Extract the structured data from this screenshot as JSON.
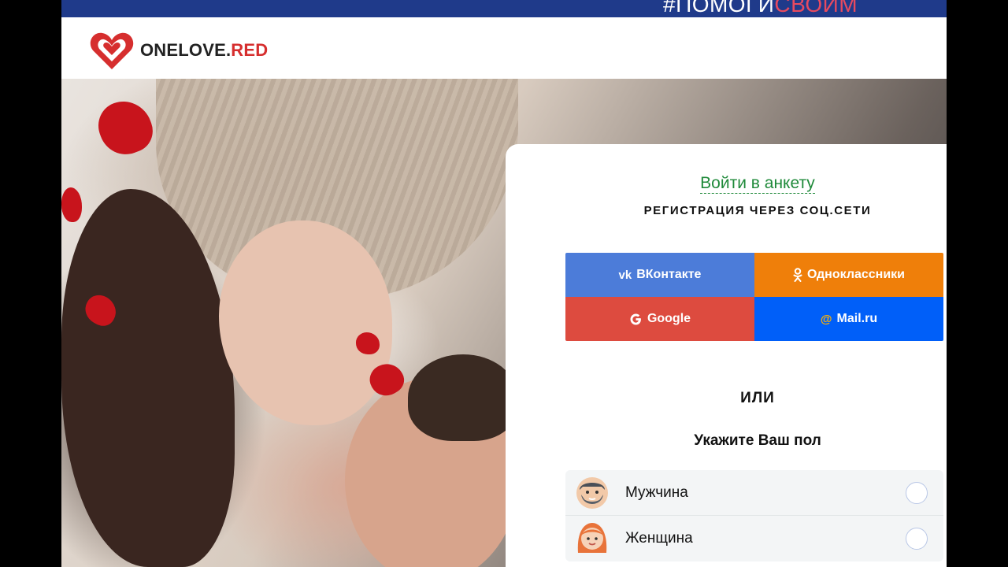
{
  "topbar": {
    "tag_part1": "#ПОМОГИ",
    "tag_part2": "СВОИМ"
  },
  "brand": {
    "name_prefix": "ONELOVE.",
    "name_suffix": "RED",
    "color": "#d62e2e"
  },
  "panel": {
    "login_link": "Войти в анкету",
    "social_title": "РЕГИСТРАЦИЯ ЧЕРЕЗ СОЦ.СЕТИ",
    "social_buttons": [
      {
        "label": "ВКонтакте",
        "icon": "vk-icon",
        "color": "#4c7cd9"
      },
      {
        "label": "Одноклассники",
        "icon": "odnoklassniki-icon",
        "color": "#ef7f0a"
      },
      {
        "label": "Google",
        "icon": "google-icon",
        "color": "#dd4b3f"
      },
      {
        "label": "Mail.ru",
        "icon": "at-icon",
        "color": "#005ff9"
      }
    ],
    "or_label": "ИЛИ",
    "gender_title": "Укажите Ваш пол",
    "gender_options": [
      {
        "label": "Мужчина",
        "icon": "man-avatar-icon",
        "selected": false
      },
      {
        "label": "Женщина",
        "icon": "woman-avatar-icon",
        "selected": false
      }
    ]
  },
  "colors": {
    "accent_green": "#1f8a3a",
    "topbar": "#1f3a8a",
    "tag_highlight": "#e84a5f"
  }
}
